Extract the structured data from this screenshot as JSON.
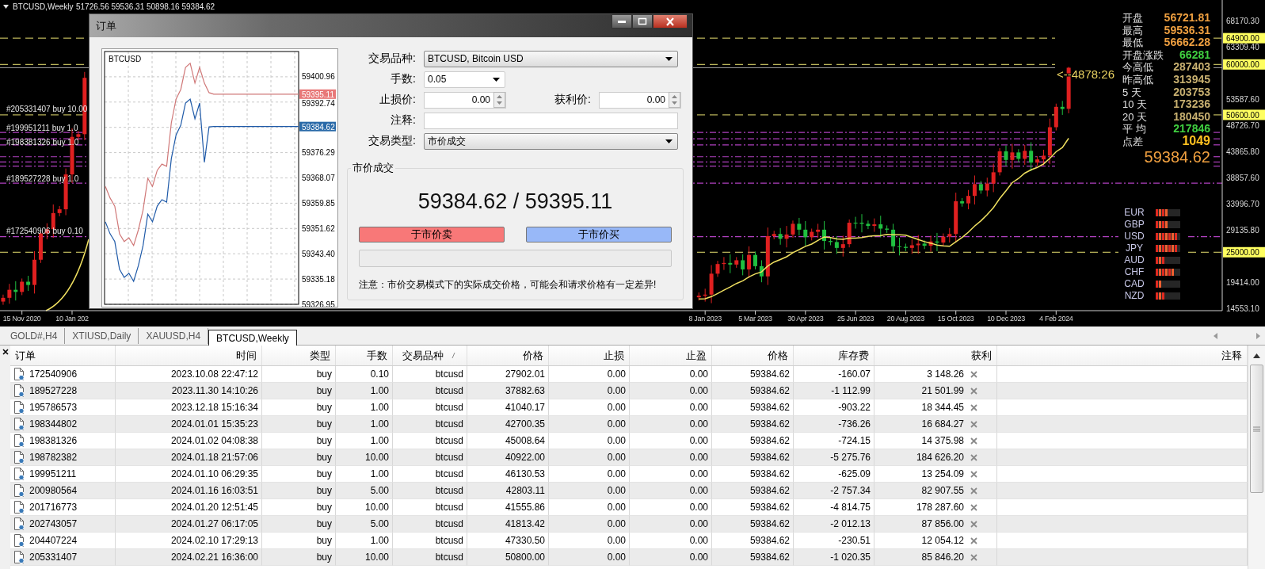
{
  "chart": {
    "symbol": "BTCUSD,Weekly",
    "ohlc": "51726.56 59536.31 50898.16 59384.62",
    "order_labels": [
      {
        "text": "#205331407 buy 10.00"
      },
      {
        "text": "#199951211 buy 1.0"
      },
      {
        "text": "#198381326 buy 1.0"
      },
      {
        "text": "#189527228 buy 1.0"
      },
      {
        "text": "#172540906 buy 0.10"
      }
    ],
    "price_levels": [
      "64900.00",
      "60000.00",
      "50600.00",
      "25000.00"
    ],
    "chart_data": {
      "type": "candlestick",
      "categories": [
        null,
        null,
        null,
        "15 Nov 2020",
        null,
        null,
        null,
        null,
        null,
        null,
        null,
        "10 Jan 202",
        null,
        null,
        null,
        null,
        null,
        null,
        null,
        null,
        null,
        null,
        null,
        null,
        null,
        null,
        null,
        null,
        null,
        null,
        null,
        null,
        null,
        null,
        null,
        null,
        null,
        null,
        null,
        null,
        null,
        null,
        null,
        null,
        null,
        null,
        null,
        null,
        null,
        null,
        null,
        null,
        null,
        null,
        null,
        null,
        null,
        null,
        null,
        null,
        null,
        null,
        null,
        null,
        null,
        null,
        null,
        null,
        null,
        null,
        null,
        null,
        null,
        null,
        null,
        null,
        null,
        null,
        null,
        null,
        null,
        null,
        null,
        null,
        null,
        null,
        null,
        null,
        null,
        null,
        null,
        null,
        null,
        null,
        null,
        null,
        null,
        null,
        null,
        null,
        null,
        null,
        null,
        null,
        null,
        null,
        null,
        null,
        null,
        null,
        null,
        null,
        "8 Jan 2023",
        null,
        null,
        null,
        null,
        null,
        null,
        null,
        "5 Mar 2023",
        null,
        null,
        null,
        null,
        null,
        null,
        null,
        "30 Apr 2023",
        null,
        null,
        null,
        null,
        null,
        null,
        null,
        "25 Jun 2023",
        null,
        null,
        null,
        null,
        null,
        null,
        null,
        "20 Aug 2023",
        null,
        null,
        null,
        null,
        null,
        null,
        null,
        "15 Oct 2023",
        null,
        null,
        null,
        null,
        null,
        null,
        null,
        "10 Dec 2023",
        null,
        null,
        null,
        null,
        null,
        null,
        null,
        "4 Feb 2024",
        null,
        null,
        null,
        null,
        null,
        null,
        null,
        null,
        null,
        null,
        null,
        null,
        null,
        null,
        null,
        null,
        null,
        null,
        null,
        null,
        null,
        null,
        null,
        null,
        null,
        null
      ],
      "ohlc": [
        [
          15800,
          17100,
          15200,
          16500
        ],
        [
          16500,
          19100,
          15400,
          18000
        ],
        [
          18000,
          19600,
          16000,
          17600
        ],
        [
          17600,
          20100,
          17000,
          19500
        ],
        [
          19500,
          20600,
          17800,
          18900
        ],
        [
          18900,
          25200,
          17300,
          23600
        ],
        [
          23600,
          29100,
          23000,
          28500
        ],
        [
          28500,
          30400,
          27400,
          29300
        ],
        [
          29300,
          33900,
          27700,
          32300
        ],
        [
          32300,
          33600,
          31700,
          33000
        ],
        [
          33000,
          40600,
          31900,
          39500
        ],
        [
          39500,
          48100,
          37900,
          46500
        ],
        [
          46500,
          47600,
          45900,
          47000
        ],
        [
          47000,
          58600,
          45900,
          57500
        ],
        null,
        null,
        null,
        null,
        null,
        null,
        null,
        null,
        null,
        null,
        null,
        null,
        null,
        null,
        null,
        null,
        null,
        null,
        null,
        null,
        null,
        null,
        null,
        null,
        null,
        null,
        null,
        null,
        null,
        null,
        null,
        null,
        null,
        null,
        null,
        null,
        null,
        null,
        null,
        null,
        null,
        null,
        null,
        null,
        null,
        null,
        null,
        null,
        null,
        null,
        null,
        null,
        null,
        null,
        null,
        null,
        null,
        null,
        null,
        null,
        null,
        null,
        null,
        null,
        null,
        null,
        null,
        null,
        null,
        null,
        null,
        null,
        null,
        null,
        null,
        null,
        null,
        null,
        null,
        null,
        null,
        null,
        null,
        null,
        null,
        null,
        null,
        null,
        null,
        null,
        null,
        null,
        null,
        null,
        null,
        null,
        null,
        [
          16600,
          17500,
          16000,
          16900
        ],
        [
          16900,
          18200,
          15800,
          17100
        ],
        [
          17100,
          22600,
          15500,
          21000
        ],
        [
          21000,
          23400,
          20400,
          22800
        ],
        [
          22800,
          24100,
          21700,
          23000
        ],
        [
          23000,
          24600,
          21100,
          22700
        ],
        [
          22700,
          24100,
          22100,
          23500
        ],
        [
          23500,
          24600,
          20700,
          21800
        ],
        [
          21800,
          26100,
          20200,
          24500
        ],
        [
          24500,
          25100,
          21800,
          22400
        ],
        [
          22400,
          23500,
          19400,
          20500
        ],
        [
          20500,
          29600,
          18900,
          28000
        ],
        [
          28000,
          29000,
          27400,
          28400
        ],
        [
          28400,
          29500,
          26400,
          27500
        ],
        [
          27500,
          29900,
          25900,
          28300
        ],
        [
          28300,
          30900,
          27700,
          30300
        ],
        [
          30300,
          31400,
          28100,
          29200
        ],
        [
          29200,
          30800,
          26200,
          27800
        ],
        [
          27800,
          29400,
          27200,
          28800
        ],
        [
          28800,
          30300,
          27700,
          29200
        ],
        [
          29200,
          30800,
          25500,
          27100
        ],
        [
          27100,
          27700,
          26300,
          26900
        ],
        [
          26900,
          28000,
          24700,
          25800
        ],
        [
          25800,
          28100,
          24200,
          26500
        ],
        [
          26500,
          31100,
          25900,
          30500
        ],
        [
          30500,
          31600,
          29400,
          30500
        ],
        [
          30500,
          32100,
          28700,
          30300
        ],
        [
          30300,
          30900,
          29300,
          29900
        ],
        [
          29900,
          31300,
          28800,
          30200
        ],
        [
          30200,
          31800,
          27800,
          29400
        ],
        [
          29400,
          30000,
          28600,
          29200
        ],
        [
          29200,
          30300,
          25000,
          26100
        ],
        [
          26100,
          27700,
          24400,
          26000
        ],
        [
          26000,
          26600,
          25200,
          25800
        ],
        [
          25800,
          27400,
          24700,
          26300
        ],
        [
          26300,
          28200,
          24700,
          26600
        ],
        [
          26600,
          27200,
          25600,
          26200
        ],
        [
          26200,
          28100,
          25100,
          27000
        ],
        [
          27000,
          28600,
          25200,
          26800
        ],
        [
          26800,
          28500,
          26200,
          27900
        ],
        [
          27900,
          29500,
          26800,
          28400
        ],
        [
          28400,
          36100,
          26800,
          34500
        ],
        [
          34500,
          35100,
          33500,
          34100
        ],
        [
          34100,
          36600,
          33000,
          35500
        ],
        [
          35500,
          39300,
          33900,
          37700
        ],
        [
          37700,
          38300,
          35900,
          36500
        ],
        [
          36500,
          38900,
          35400,
          37800
        ],
        [
          37800,
          41500,
          36200,
          39900
        ],
        [
          39900,
          44400,
          39300,
          43800
        ],
        [
          43800,
          44900,
          41100,
          42200
        ],
        [
          42200,
          45200,
          40600,
          43600
        ],
        [
          43600,
          44200,
          41800,
          42400
        ],
        [
          42400,
          45000,
          41300,
          43900
        ],
        [
          43900,
          45500,
          40100,
          41700
        ],
        [
          41700,
          42900,
          41100,
          42300
        ],
        [
          42300,
          44100,
          41200,
          43000
        ],
        [
          43000,
          49900,
          41400,
          48300
        ],
        [
          48300,
          52700,
          47700,
          52100
        ],
        [
          52100,
          53200,
          50600,
          51700
        ],
        [
          51726.56,
          59536.31,
          50898.16,
          59384.62
        ],
        null,
        null,
        null,
        null,
        null,
        null,
        null,
        null,
        null,
        null,
        null,
        null,
        null,
        null,
        null,
        null,
        null,
        null,
        null,
        null,
        null,
        null,
        null,
        null
      ],
      "ylim": [
        14110,
        72010
      ],
      "yticks": [
        {
          "value": 68170.3,
          "label": "68170.30"
        },
        {
          "value": 63309.4,
          "label": "63309.40"
        },
        {
          "value": 53587.6,
          "label": "53587.60"
        },
        {
          "value": 48726.7,
          "label": "48726.70"
        },
        {
          "value": 43865.8,
          "label": "43865.80"
        },
        {
          "value": 38857.6,
          "label": "38857.60"
        },
        {
          "value": 33996.7,
          "label": "33996.70"
        },
        {
          "value": 29135.8,
          "label": "29135.80"
        },
        {
          "value": 19414,
          "label": "19414.00"
        },
        {
          "value": 14553.1,
          "label": "14553.10"
        }
      ]
    },
    "countdown": "<--4878:26",
    "info": [
      {
        "label": "开盘",
        "value": "56721.81",
        "color": "#f0a040"
      },
      {
        "label": "最高",
        "value": "59536.31",
        "color": "#f0a040"
      },
      {
        "label": "最低",
        "value": "56662.28",
        "color": "#f0a040"
      },
      {
        "label": "开盘涨跌",
        "value": "66281",
        "color": "#40d040"
      },
      {
        "label": "今高低",
        "value": "287403",
        "color": "#c8b070"
      },
      {
        "label": "昨高低",
        "value": "313945",
        "color": "#c8b070"
      },
      {
        "label": "5 天",
        "value": "203753",
        "color": "#c8b070"
      },
      {
        "label": "10 天",
        "value": "173236",
        "color": "#c8b070"
      },
      {
        "label": "20 天",
        "value": "180450",
        "color": "#c8b070"
      },
      {
        "label": "平 均",
        "value": "217846",
        "color": "#40d040"
      },
      {
        "label": "点差",
        "value": "1049",
        "color": "#ffc020"
      }
    ],
    "bid_price": "59384.62",
    "currency_strength": [
      {
        "code": "EUR",
        "level": 0.5
      },
      {
        "code": "GBP",
        "level": 0.5
      },
      {
        "code": "USD",
        "level": 0.875
      },
      {
        "code": "JPY",
        "level": 0.875
      },
      {
        "code": "AUD",
        "level": 0.375
      },
      {
        "code": "CHF",
        "level": 0.75
      },
      {
        "code": "CAD",
        "level": 0.25
      },
      {
        "code": "NZD",
        "level": 0.375
      }
    ]
  },
  "order_dialog": {
    "title": "订单",
    "mini_chart": {
      "symbol": "BTCUSD",
      "price_tags": [
        {
          "label": "59395.11",
          "kind": "ask"
        },
        {
          "label": "59384.62",
          "kind": "bid"
        }
      ],
      "chart_data": {
        "type": "line",
        "grid": true,
        "series": [
          {
            "color": "#d07878",
            "values": [
              59365.2,
              59361.4,
              59358.8,
              59349.8,
              59347.3,
              59348.5,
              59346.0,
              59351.1,
              59357.5,
              59367.8,
              59365.2,
              59370.4,
              59372.4,
              59371.7,
              59385.8,
              59393.5,
              59396.6,
              59403.8,
              59405.1,
              59398.7,
              59403.8,
              59398.7,
              59395.6,
              59395.1,
              59395.1,
              59395.1,
              59395.1,
              59395.1,
              59395.1,
              59395.1,
              59395.1,
              59395.1,
              59395.1,
              59395.1,
              59395.1,
              59395.1,
              59395.1,
              59395.1,
              59395.1,
              59395.1,
              59395.1,
              59395.1
            ]
          },
          {
            "color": "#1f5aa8",
            "values": [
              59353.7,
              59349.8,
              59347.3,
              59338.3,
              59335.7,
              59337.0,
              59334.4,
              59339.5,
              59346.0,
              59356.2,
              59353.7,
              59358.8,
              59360.9,
              59360.1,
              59374.2,
              59381.9,
              59385.0,
              59392.2,
              59393.5,
              59387.1,
              59392.2,
              59373.0,
              59384.5,
              59384.6,
              59384.6,
              59384.6,
              59384.6,
              59384.6,
              59384.6,
              59384.6,
              59384.6,
              59384.6,
              59384.6,
              59384.6,
              59384.6,
              59384.6,
              59384.6,
              59384.6,
              59384.6,
              59384.6,
              59384.6,
              59384.6
            ]
          }
        ],
        "ylim": [
          59326.95,
          59408.93
        ],
        "yticks": [
          {
            "value": 59400.96,
            "label": "59400.96"
          },
          {
            "value": 59392.74,
            "label": "59392.74"
          },
          {
            "value": 59376.29,
            "label": "59376.29"
          },
          {
            "value": 59368.07,
            "label": "59368.07"
          },
          {
            "value": 59359.85,
            "label": "59359.85"
          },
          {
            "value": 59351.62,
            "label": "59351.62"
          },
          {
            "value": 59343.4,
            "label": "59343.40"
          },
          {
            "value": 59335.18,
            "label": "59335.18"
          },
          {
            "value": 59326.95,
            "label": "59326.95"
          }
        ]
      }
    },
    "symbol_label": "交易品种:",
    "symbol_value": "BTCUSD, Bitcoin USD",
    "lots_label": "手数:",
    "lots_value": "0.05",
    "stop_loss_label": "止损价:",
    "stop_loss_value": "0.00",
    "take_profit_label": "获利价:",
    "take_profit_value": "0.00",
    "comment_label": "注释:",
    "type_label": "交易类型:",
    "type_value": "市价成交",
    "group_title": "市价成交",
    "prices": "59384.62 / 59395.11",
    "sell_button": "于市价卖",
    "buy_button": "于市价买",
    "note": "注意：市价交易模式下的实际成交价格，可能会和请求价格有一定差异!"
  },
  "tabs": [
    {
      "label": "GOLD#,H4",
      "selected": false
    },
    {
      "label": "XTIUSD,Daily",
      "selected": false
    },
    {
      "label": "XAUUSD,H4",
      "selected": false
    },
    {
      "label": "BTCUSD,Weekly",
      "selected": true
    }
  ],
  "trades": {
    "columns": [
      "订单",
      "时间",
      "类型",
      "手数",
      "交易品种",
      "价格",
      "止损",
      "止盈",
      "价格",
      "库存费",
      "获利",
      "注释"
    ],
    "rows": [
      [
        "172540906",
        "2023.10.08 22:47:12",
        "buy",
        "0.10",
        "btcusd",
        "27902.01",
        "0.00",
        "0.00",
        "59384.62",
        "-160.07",
        "3 148.26"
      ],
      [
        "189527228",
        "2023.11.30 14:10:26",
        "buy",
        "1.00",
        "btcusd",
        "37882.63",
        "0.00",
        "0.00",
        "59384.62",
        "-1 112.99",
        "21 501.99"
      ],
      [
        "195786573",
        "2023.12.18 15:16:34",
        "buy",
        "1.00",
        "btcusd",
        "41040.17",
        "0.00",
        "0.00",
        "59384.62",
        "-903.22",
        "18 344.45"
      ],
      [
        "198344802",
        "2024.01.01 15:35:23",
        "buy",
        "1.00",
        "btcusd",
        "42700.35",
        "0.00",
        "0.00",
        "59384.62",
        "-736.26",
        "16 684.27"
      ],
      [
        "198381326",
        "2024.01.02 04:08:38",
        "buy",
        "1.00",
        "btcusd",
        "45008.64",
        "0.00",
        "0.00",
        "59384.62",
        "-724.15",
        "14 375.98"
      ],
      [
        "198782382",
        "2024.01.18 21:57:06",
        "buy",
        "10.00",
        "btcusd",
        "40922.00",
        "0.00",
        "0.00",
        "59384.62",
        "-5 275.76",
        "184 626.20"
      ],
      [
        "199951211",
        "2024.01.10 06:29:35",
        "buy",
        "1.00",
        "btcusd",
        "46130.53",
        "0.00",
        "0.00",
        "59384.62",
        "-625.09",
        "13 254.09"
      ],
      [
        "200980564",
        "2024.01.16 16:03:51",
        "buy",
        "5.00",
        "btcusd",
        "42803.11",
        "0.00",
        "0.00",
        "59384.62",
        "-2 757.34",
        "82 907.55"
      ],
      [
        "201716773",
        "2024.01.20 12:51:45",
        "buy",
        "10.00",
        "btcusd",
        "41555.86",
        "0.00",
        "0.00",
        "59384.62",
        "-4 814.75",
        "178 287.60"
      ],
      [
        "202743057",
        "2024.01.27 06:17:05",
        "buy",
        "5.00",
        "btcusd",
        "41813.42",
        "0.00",
        "0.00",
        "59384.62",
        "-2 012.13",
        "87 856.00"
      ],
      [
        "204407224",
        "2024.02.10 17:29:13",
        "buy",
        "1.00",
        "btcusd",
        "47330.50",
        "0.00",
        "0.00",
        "59384.62",
        "-230.51",
        "12 054.12"
      ],
      [
        "205331407",
        "2024.02.21 16:36:00",
        "buy",
        "10.00",
        "btcusd",
        "50800.00",
        "0.00",
        "0.00",
        "59384.62",
        "-1 020.35",
        "85 846.20"
      ]
    ]
  }
}
